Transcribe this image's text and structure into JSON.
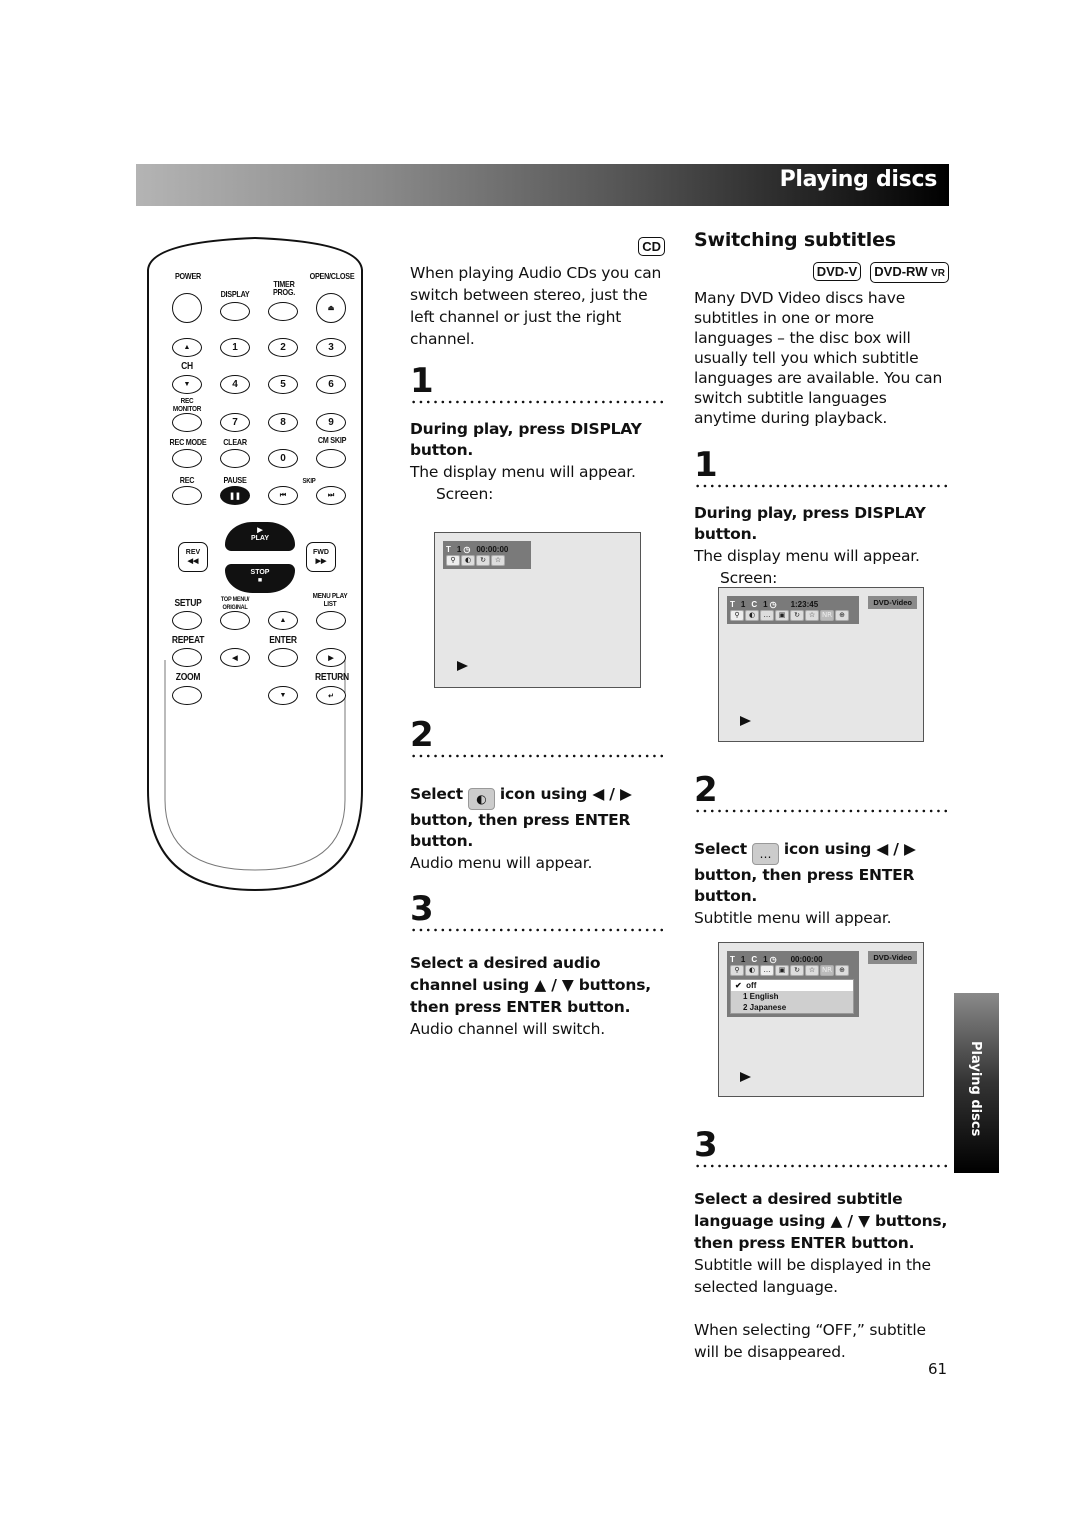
{
  "header": {
    "title": "Playing discs"
  },
  "remote": {
    "labels": {
      "power": "POWER",
      "display": "DISPLAY",
      "timer_prog": "TIMER PROG.",
      "open_close": "OPEN/CLOSE",
      "ch": "CH",
      "rec_monitor": "REC MONITOR",
      "rec_mode": "REC MODE",
      "clear": "CLEAR",
      "cm_skip": "CM SKIP",
      "rec": "REC",
      "pause": "PAUSE",
      "skip": "SKIP",
      "play": "PLAY",
      "stop": "STOP",
      "rev": "REV",
      "fwd": "FWD",
      "setup": "SETUP",
      "top_menu": "TOP MENU/ ORIGINAL",
      "menu": "MENU PLAY LIST",
      "repeat": "REPEAT",
      "enter": "ENTER",
      "zoom": "ZOOM",
      "return": "RETURN"
    },
    "digits": [
      "1",
      "2",
      "3",
      "4",
      "5",
      "6",
      "7",
      "8",
      "9",
      "0"
    ]
  },
  "cd_section": {
    "badge": "CD",
    "intro": "When playing Audio CDs you can switch between stereo, just the left channel or just the right channel.",
    "steps": [
      {
        "num": "1",
        "instruction": "During play, press DISPLAY button.",
        "note": "The display menu will appear.",
        "sub_note": "Screen:"
      },
      {
        "num": "2",
        "instruction_pre": "Select",
        "icon": "audio-icon",
        "instruction_post": "icon using ◀ / ▶ button, then press ENTER button.",
        "note": "Audio menu will appear."
      },
      {
        "num": "3",
        "instruction": "Select a desired audio channel using ▲ / ▼ buttons, then press ENTER button.",
        "note": "Audio channel will switch."
      }
    ],
    "screen": {
      "title_label": "T",
      "title_num": "1",
      "time": "00:00:00"
    }
  },
  "subtitle_section": {
    "title": "Switching subtitles",
    "badges": [
      "DVD-V",
      "DVD-RW",
      "VR"
    ],
    "intro": "Many DVD Video discs have subtitles in one or more languages – the disc box will usually tell you which subtitle languages are available. You can switch subtitle languages anytime during playback.",
    "steps": [
      {
        "num": "1",
        "instruction": "During play, press DISPLAY button.",
        "note": "The display menu will appear.",
        "sub_note": "Screen:"
      },
      {
        "num": "2",
        "instruction_pre": "Select",
        "icon": "subtitle-icon",
        "instruction_post": "icon using ◀ / ▶ button, then press ENTER button.",
        "note": "Subtitle menu will appear."
      },
      {
        "num": "3",
        "instruction": "Select a desired subtitle language using ▲ / ▼ buttons, then press ENTER button.",
        "note": "Subtitle will be displayed in the selected language.",
        "extra": "When selecting “OFF,” subtitle will be disappeared."
      }
    ],
    "screen1": {
      "title_label": "T",
      "title_num": "1",
      "chapter_label": "C",
      "chapter_num": "1",
      "time": "1:23:45",
      "disc_type": "DVD-Video"
    },
    "screen2": {
      "title_label": "T",
      "title_num": "1",
      "chapter_label": "C",
      "chapter_num": "1",
      "time": "00:00:00",
      "disc_type": "DVD-Video",
      "menu_options": [
        "off",
        "1 English",
        "2 Japanese"
      ],
      "selected_option": "off",
      "check": "✔"
    }
  },
  "side_tab": {
    "label": "Playing discs"
  },
  "page_number": "61"
}
